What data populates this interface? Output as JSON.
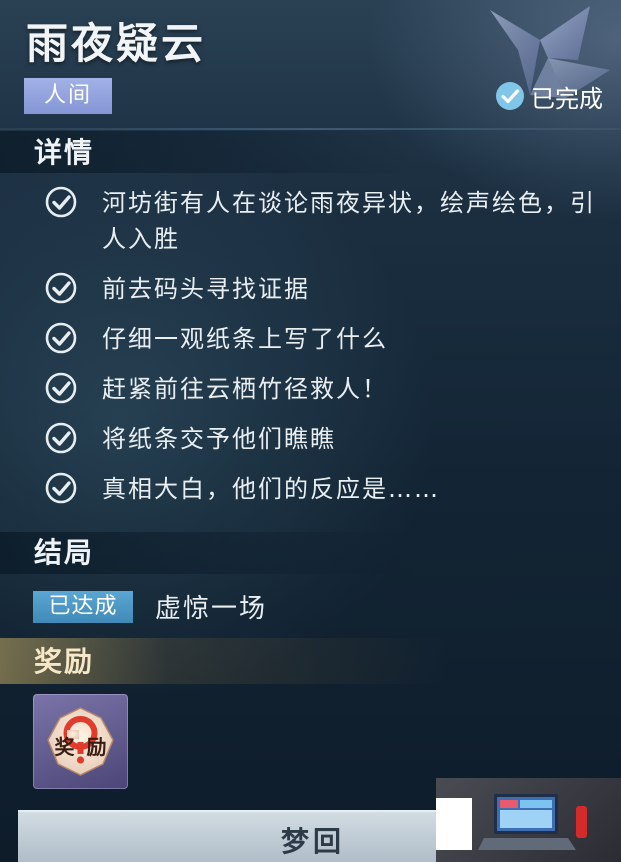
{
  "quest": {
    "title": "雨夜疑云",
    "category": "人间",
    "status": "已完成",
    "status_color": "#7fc6e8"
  },
  "details": {
    "heading": "详情",
    "tasks": [
      {
        "text": "河坊街有人在谈论雨夜异状，绘声绘色，引人入胜",
        "completed": true
      },
      {
        "text": "前去码头寻找证据",
        "completed": true
      },
      {
        "text": "仔细一观纸条上写了什么",
        "completed": true
      },
      {
        "text": "赶紧前往云栖竹径救人！",
        "completed": true
      },
      {
        "text": "将纸条交予他们瞧瞧",
        "completed": true
      },
      {
        "text": "真相大白，他们的反应是……",
        "completed": true
      }
    ]
  },
  "ending": {
    "heading": "结局",
    "badge": "已达成",
    "text": "虚惊一场"
  },
  "reward": {
    "heading": "奖励",
    "item_label": "奖励",
    "item_icon": "mystery-reward-icon"
  },
  "actions": {
    "return_label": "梦回"
  },
  "icons": {
    "task_check": "check-circle-icon",
    "status": "checkmark-badge-icon"
  }
}
